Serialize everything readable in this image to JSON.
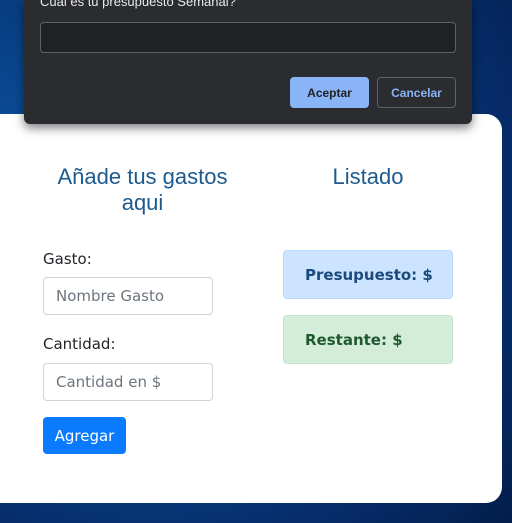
{
  "dialog": {
    "message": "Cuál es tu presupuesto Semanal?",
    "input_value": "",
    "ok_label": "Aceptar",
    "cancel_label": "Cancelar"
  },
  "form": {
    "title": "Añade tus gastos aqui",
    "gasto_label": "Gasto:",
    "gasto_placeholder": "Nombre Gasto",
    "cantidad_label": "Cantidad:",
    "cantidad_placeholder": "Cantidad en $",
    "submit_label": "Agregar"
  },
  "listado": {
    "title": "Listado",
    "presupuesto_label": "Presupuesto: $",
    "restante_label": "Restante: $"
  },
  "colors": {
    "accent": "#0a7bff",
    "heading": "#1d5a8e",
    "info_bg": "#cce4ff",
    "success_bg": "#d4edda",
    "dialog_bg": "#2b2c2f",
    "dialog_accent": "#8ab4f8"
  }
}
